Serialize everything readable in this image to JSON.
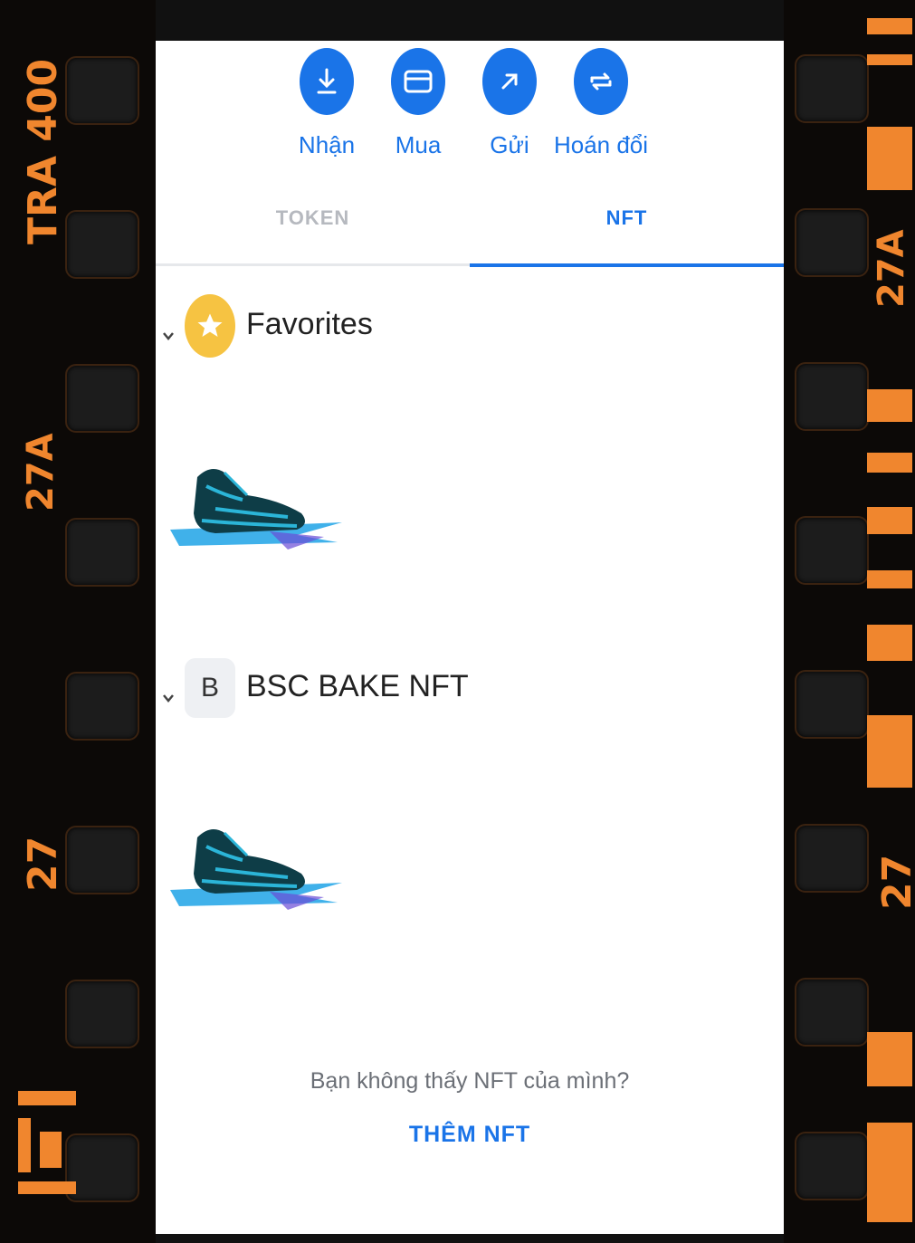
{
  "actions": [
    {
      "label": "Nhận",
      "icon": "receive-icon"
    },
    {
      "label": "Mua",
      "icon": "card-icon"
    },
    {
      "label": "Gửi",
      "icon": "send-arrow-icon"
    },
    {
      "label": "Hoán đổi",
      "icon": "swap-icon"
    }
  ],
  "tabs": {
    "token": "TOKEN",
    "nft": "NFT",
    "active": "NFT"
  },
  "groups": [
    {
      "title": "Favorites",
      "icon": "star-icon",
      "items": [
        "sneaker-nft"
      ]
    },
    {
      "title": "BSC BAKE NFT",
      "badge": "B",
      "items": [
        "sneaker-nft"
      ]
    }
  ],
  "footer": {
    "note": "Bạn không thấy NFT của mình?",
    "add_label": "THÊM NFT"
  },
  "film_edge": {
    "left_top": "TRA 400",
    "left_mid": "27A",
    "left_low": "27",
    "right_mid": "27A",
    "right_low": "27"
  },
  "colors": {
    "accent": "#1a74e8",
    "favorite": "#f6c342",
    "film_edge": "#f0862e"
  }
}
